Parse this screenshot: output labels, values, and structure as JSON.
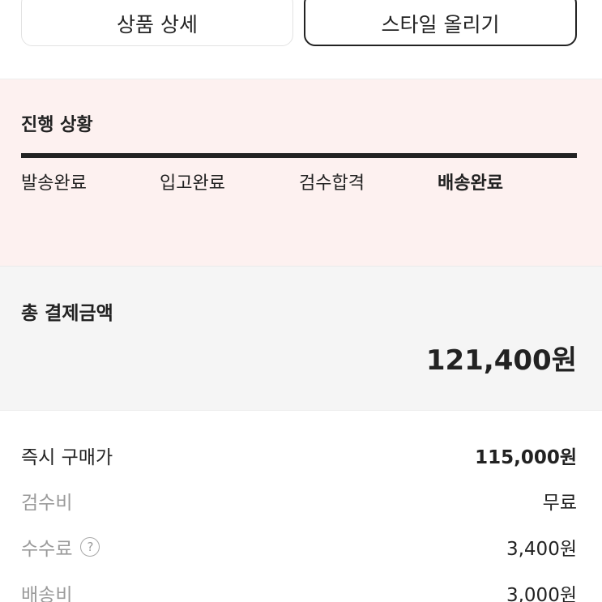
{
  "top_buttons": {
    "product_detail": "상품 상세",
    "post_style": "스타일 올리기"
  },
  "progress": {
    "title": "진행 상황",
    "steps": [
      {
        "label": "발송완료",
        "active": false
      },
      {
        "label": "입고완료",
        "active": false
      },
      {
        "label": "검수합격",
        "active": false
      },
      {
        "label": "배송완료",
        "active": true
      }
    ],
    "completion_fraction": 1.0
  },
  "total": {
    "label": "총 결제금액",
    "amount": "121,400원"
  },
  "breakdown": [
    {
      "label": "즉시 구매가",
      "value": "115,000원",
      "muted": false,
      "bold_value": true
    },
    {
      "label": "검수비",
      "value": "무료",
      "muted": true,
      "bold_value": false
    },
    {
      "label": "수수료",
      "value": "3,400원",
      "muted": true,
      "bold_value": false,
      "help_icon": "question-circle-icon"
    },
    {
      "label": "배송비",
      "value": "3,000원",
      "muted": true,
      "bold_value": false
    }
  ],
  "colors": {
    "progress_bg": "#fdf1f0",
    "total_bg": "#f5f5f5",
    "muted_text": "#9a9a9a",
    "primary_text": "#222222"
  }
}
